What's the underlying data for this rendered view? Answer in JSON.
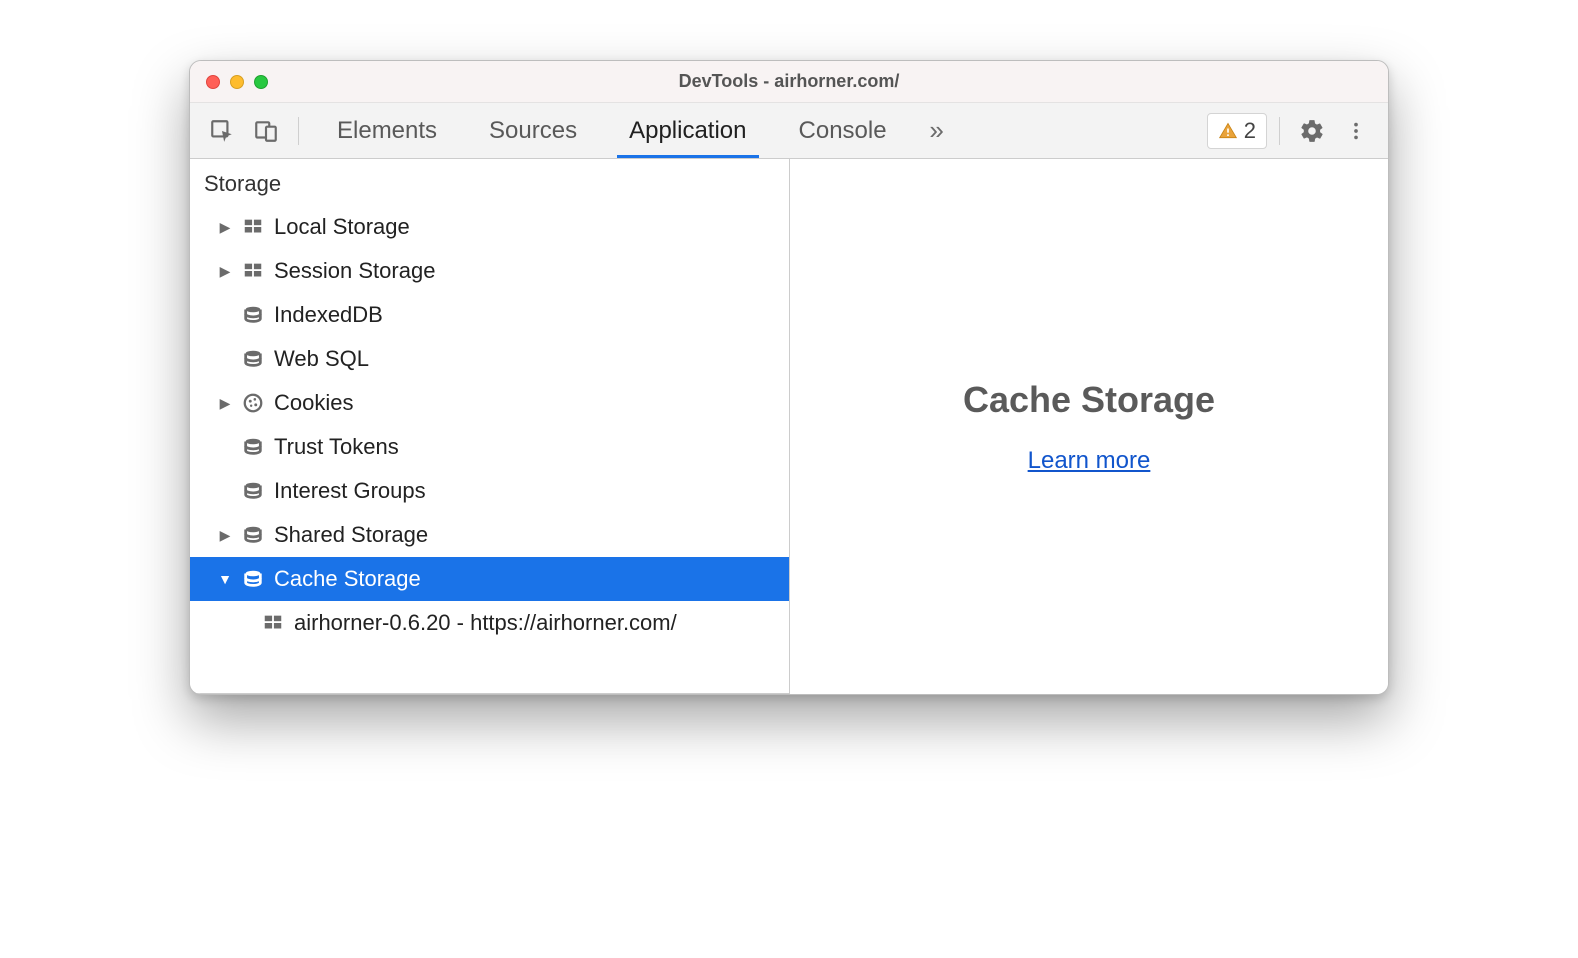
{
  "window": {
    "title": "DevTools - airhorner.com/"
  },
  "toolbar": {
    "tabs": [
      "Elements",
      "Sources",
      "Application",
      "Console"
    ],
    "active_tab_index": 2,
    "issues_count": "2"
  },
  "sidebar": {
    "section_title": "Storage",
    "items": [
      {
        "label": "Local Storage",
        "icon": "grid",
        "expandable": true,
        "expanded": false
      },
      {
        "label": "Session Storage",
        "icon": "grid",
        "expandable": true,
        "expanded": false
      },
      {
        "label": "IndexedDB",
        "icon": "database",
        "expandable": false
      },
      {
        "label": "Web SQL",
        "icon": "database",
        "expandable": false
      },
      {
        "label": "Cookies",
        "icon": "cookie",
        "expandable": true,
        "expanded": false
      },
      {
        "label": "Trust Tokens",
        "icon": "database",
        "expandable": false
      },
      {
        "label": "Interest Groups",
        "icon": "database",
        "expandable": false
      },
      {
        "label": "Shared Storage",
        "icon": "database",
        "expandable": true,
        "expanded": false
      },
      {
        "label": "Cache Storage",
        "icon": "database",
        "expandable": true,
        "expanded": true,
        "selected": true
      }
    ],
    "cache_child_label": "airhorner-0.6.20 - https://airhorner.com/"
  },
  "detail": {
    "title": "Cache Storage",
    "link_label": "Learn more"
  },
  "colors": {
    "selection": "#1a73e8",
    "link": "#1155cc"
  }
}
